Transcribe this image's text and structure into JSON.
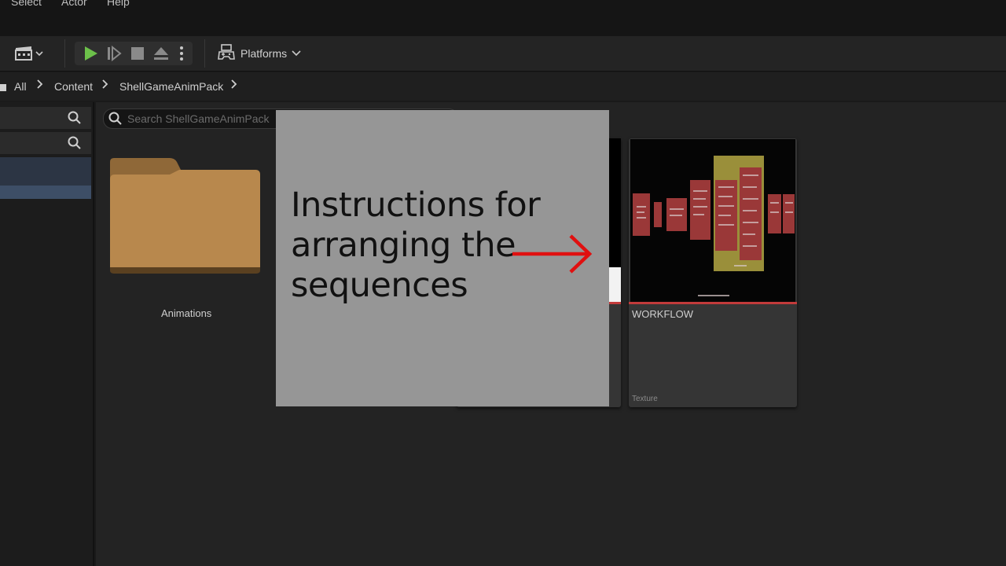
{
  "menubar": {
    "items": [
      "Select",
      "Actor",
      "Help"
    ]
  },
  "toolbar": {
    "icons": [
      "cinematics-icon",
      "play-icon",
      "step-icon",
      "stop-icon",
      "eject-icon",
      "more-icon"
    ],
    "platforms_label": "Platforms"
  },
  "breadcrumb": {
    "items": [
      "All",
      "Content",
      "ShellGameAnimPack"
    ]
  },
  "content": {
    "search_placeholder": "Search ShellGameAnimPack",
    "tiles": [
      {
        "label": "Animations",
        "type": "folder"
      },
      {
        "label": "WORKFLOW",
        "type": "Texture"
      }
    ]
  },
  "overlay": {
    "text": "Instructions for arranging the sequences",
    "arrow_color": "#e01010"
  },
  "colors": {
    "folder": "#b8884d",
    "accent_red": "#c23b3b",
    "play_green": "#6cc04a",
    "selection": "#3d4e66"
  }
}
